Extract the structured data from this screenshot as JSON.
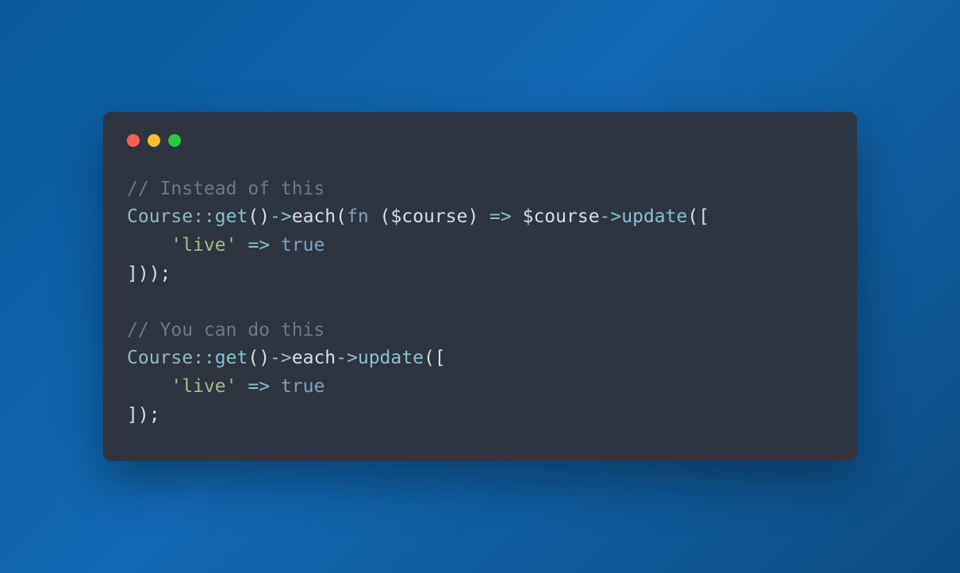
{
  "window": {
    "traffic_colors": {
      "red": "#ff5f57",
      "yellow": "#febc2e",
      "green": "#28c840"
    }
  },
  "code": {
    "tokens": [
      {
        "cls": "c-comment",
        "t": "// Instead of this"
      },
      {
        "cls": "nl"
      },
      {
        "cls": "c-class",
        "t": "Course"
      },
      {
        "cls": "c-op",
        "t": "::"
      },
      {
        "cls": "c-method",
        "t": "get"
      },
      {
        "cls": "c-plain",
        "t": "()"
      },
      {
        "cls": "c-op",
        "t": "->"
      },
      {
        "cls": "c-plain",
        "t": "each("
      },
      {
        "cls": "c-keyword",
        "t": "fn"
      },
      {
        "cls": "c-plain",
        "t": " ("
      },
      {
        "cls": "c-var",
        "t": "$course"
      },
      {
        "cls": "c-plain",
        "t": ") "
      },
      {
        "cls": "c-op",
        "t": "=>"
      },
      {
        "cls": "c-plain",
        "t": " "
      },
      {
        "cls": "c-var",
        "t": "$course"
      },
      {
        "cls": "c-op",
        "t": "->"
      },
      {
        "cls": "c-method",
        "t": "update"
      },
      {
        "cls": "c-plain",
        "t": "(["
      },
      {
        "cls": "nl"
      },
      {
        "cls": "c-plain",
        "t": "    "
      },
      {
        "cls": "c-string",
        "t": "'live'"
      },
      {
        "cls": "c-plain",
        "t": " "
      },
      {
        "cls": "c-op",
        "t": "=>"
      },
      {
        "cls": "c-plain",
        "t": " "
      },
      {
        "cls": "c-bool",
        "t": "true"
      },
      {
        "cls": "nl"
      },
      {
        "cls": "c-plain",
        "t": "]));"
      },
      {
        "cls": "nl"
      },
      {
        "cls": "nl"
      },
      {
        "cls": "c-comment",
        "t": "// You can do this"
      },
      {
        "cls": "nl"
      },
      {
        "cls": "c-class",
        "t": "Course"
      },
      {
        "cls": "c-op",
        "t": "::"
      },
      {
        "cls": "c-method",
        "t": "get"
      },
      {
        "cls": "c-plain",
        "t": "()"
      },
      {
        "cls": "c-op",
        "t": "->"
      },
      {
        "cls": "c-plain",
        "t": "each"
      },
      {
        "cls": "c-op",
        "t": "->"
      },
      {
        "cls": "c-method",
        "t": "update"
      },
      {
        "cls": "c-plain",
        "t": "(["
      },
      {
        "cls": "nl"
      },
      {
        "cls": "c-plain",
        "t": "    "
      },
      {
        "cls": "c-string",
        "t": "'live'"
      },
      {
        "cls": "c-plain",
        "t": " "
      },
      {
        "cls": "c-op",
        "t": "=>"
      },
      {
        "cls": "c-plain",
        "t": " "
      },
      {
        "cls": "c-bool",
        "t": "true"
      },
      {
        "cls": "nl"
      },
      {
        "cls": "c-plain",
        "t": "]);"
      }
    ]
  }
}
